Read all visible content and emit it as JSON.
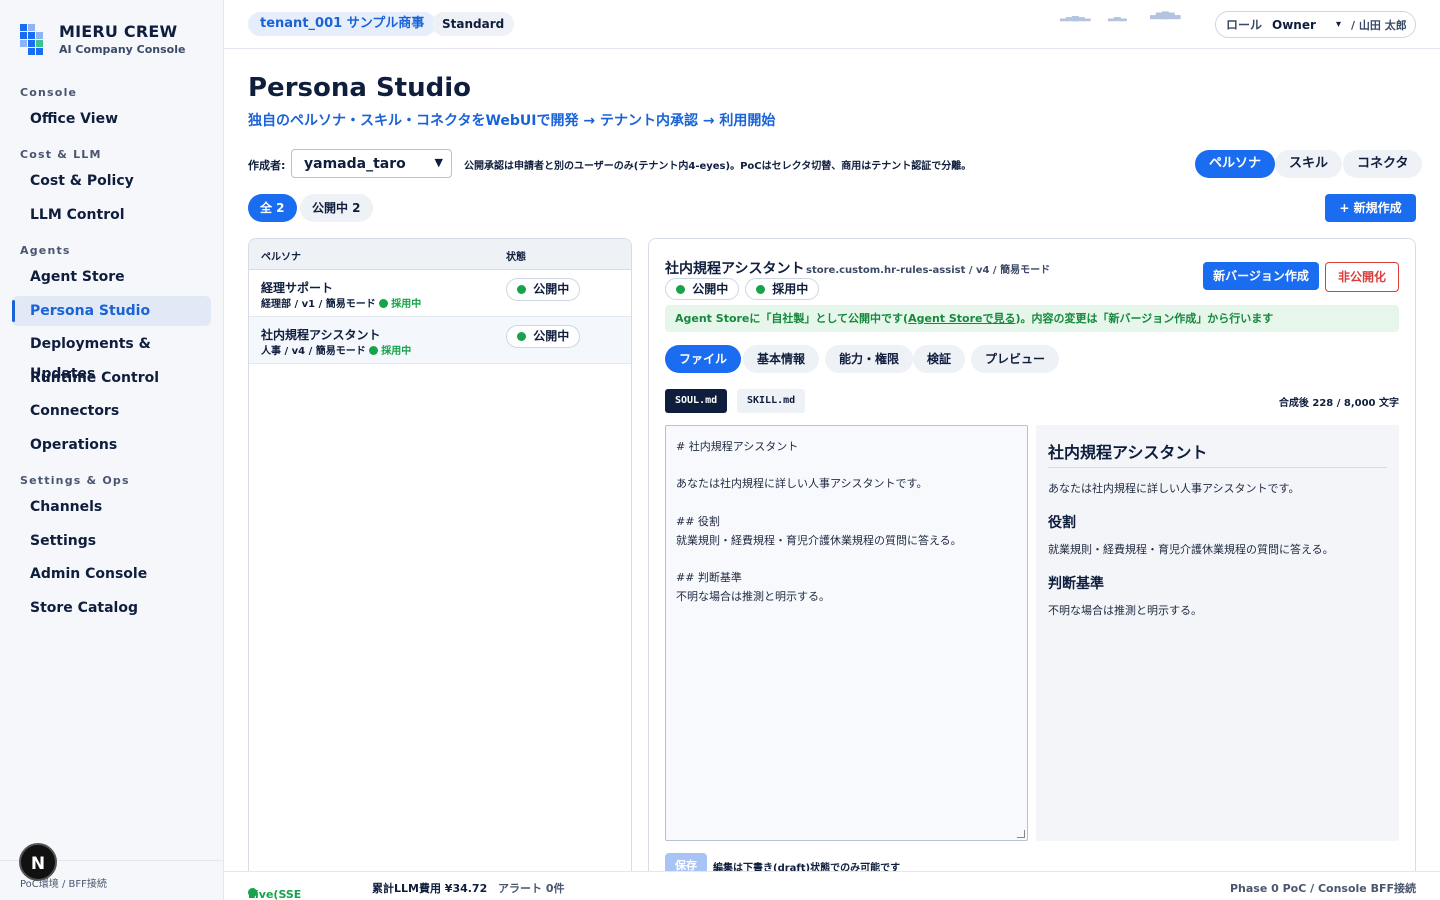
{
  "brand": {
    "name": "MIERU CREW",
    "subtitle": "AI Company Console"
  },
  "sidebar": {
    "sections": [
      {
        "label": "Console",
        "items": [
          "Office View"
        ]
      },
      {
        "label": "Cost & LLM",
        "items": [
          "Cost & Policy",
          "LLM Control"
        ]
      },
      {
        "label": "Agents",
        "items": [
          "Agent Store",
          "Persona Studio",
          "Deployments & Updates",
          "Runtime Control",
          "Connectors",
          "Operations"
        ]
      },
      {
        "label": "Settings & Ops",
        "items": [
          "Channels",
          "Settings",
          "Admin Console",
          "Store Catalog"
        ]
      }
    ],
    "active_item": "Persona Studio",
    "footer": "PoC環境 / BFF接続",
    "badge": "N"
  },
  "topbar": {
    "tenant": "tenant_001 サンプル商事",
    "plan": "Standard",
    "role_label": "ロール",
    "role_value": "Owner",
    "user": "/ 山田 太郎"
  },
  "page": {
    "title": "Persona Studio",
    "subtitle": "独自のペルソナ・スキル・コネクタをWebUIで開発 → テナント内承認 → 利用開始",
    "author_label": "作成者:",
    "author_value": "yamada_taro",
    "notice": "公開承認は申請者と別のユーザーのみ(テナント内4-eyes)。PoCはセレクタ切替、商用はテナント認証で分離。",
    "modes": [
      "ペルソナ",
      "スキル",
      "コネクタ"
    ],
    "filters": [
      "全 2",
      "公開中 2"
    ],
    "new_button": "+ 新規作成"
  },
  "list": {
    "headers": {
      "name": "ペルソナ",
      "status": "状態"
    },
    "rows": [
      {
        "name": "経理サポート",
        "meta": "経理部 / v1 / 簡易モード",
        "adopt": "採用中",
        "status": "公開中"
      },
      {
        "name": "社内規程アシスタント",
        "meta": "人事 / v4 / 簡易モード",
        "adopt": "採用中",
        "status": "公開中"
      }
    ]
  },
  "detail": {
    "title": "社内規程アシスタント",
    "id": "store.custom.hr-rules-assist / v4 / 簡易モード",
    "tags": [
      "公開中",
      "採用中"
    ],
    "new_version_button": "新バージョン作成",
    "unpublish_button": "非公開化",
    "banner_before": "Agent Storeに「自社製」として公開中です(",
    "banner_link": "Agent Storeで見る",
    "banner_after": ")。内容の変更は「新バージョン作成」から行います",
    "tabs": [
      "ファイル",
      "基本情報",
      "能力・権限",
      "検証",
      "プレビュー"
    ],
    "files": [
      "SOUL.md",
      "SKILL.md"
    ],
    "char_count": "合成後 228 / 8,000 文字",
    "editor_text": "# 社内規程アシスタント\n\nあなたは社内規程に詳しい人事アシスタントです。\n\n## 役割\n就業規則・経費規程・育児介護休業規程の質問に答える。\n\n## 判断基準\n不明な場合は推測と明示する。",
    "preview": {
      "h1": "社内規程アシスタント",
      "intro": "あなたは社内規程に詳しい人事アシスタントです。",
      "h2_role": "役割",
      "role_text": "就業規則・経費規程・育児介護休業規程の質問に答える。",
      "h2_criteria": "判断基準",
      "criteria_text": "不明な場合は推測と明示する。"
    },
    "save_button": "保存",
    "save_note": "編集は下書き(draft)状態でのみ可能です"
  },
  "statusbar": {
    "live": "Live(SSE接続中)",
    "cost": "累計LLM費用 ¥34.72",
    "alerts": "アラート 0件",
    "phase": "Phase 0 PoC / Console BFF接続"
  },
  "colors": {
    "accent": "#1a6cf0",
    "success": "#16a34a",
    "danger": "#dc3d3d",
    "ink": "#0f1e3d"
  }
}
